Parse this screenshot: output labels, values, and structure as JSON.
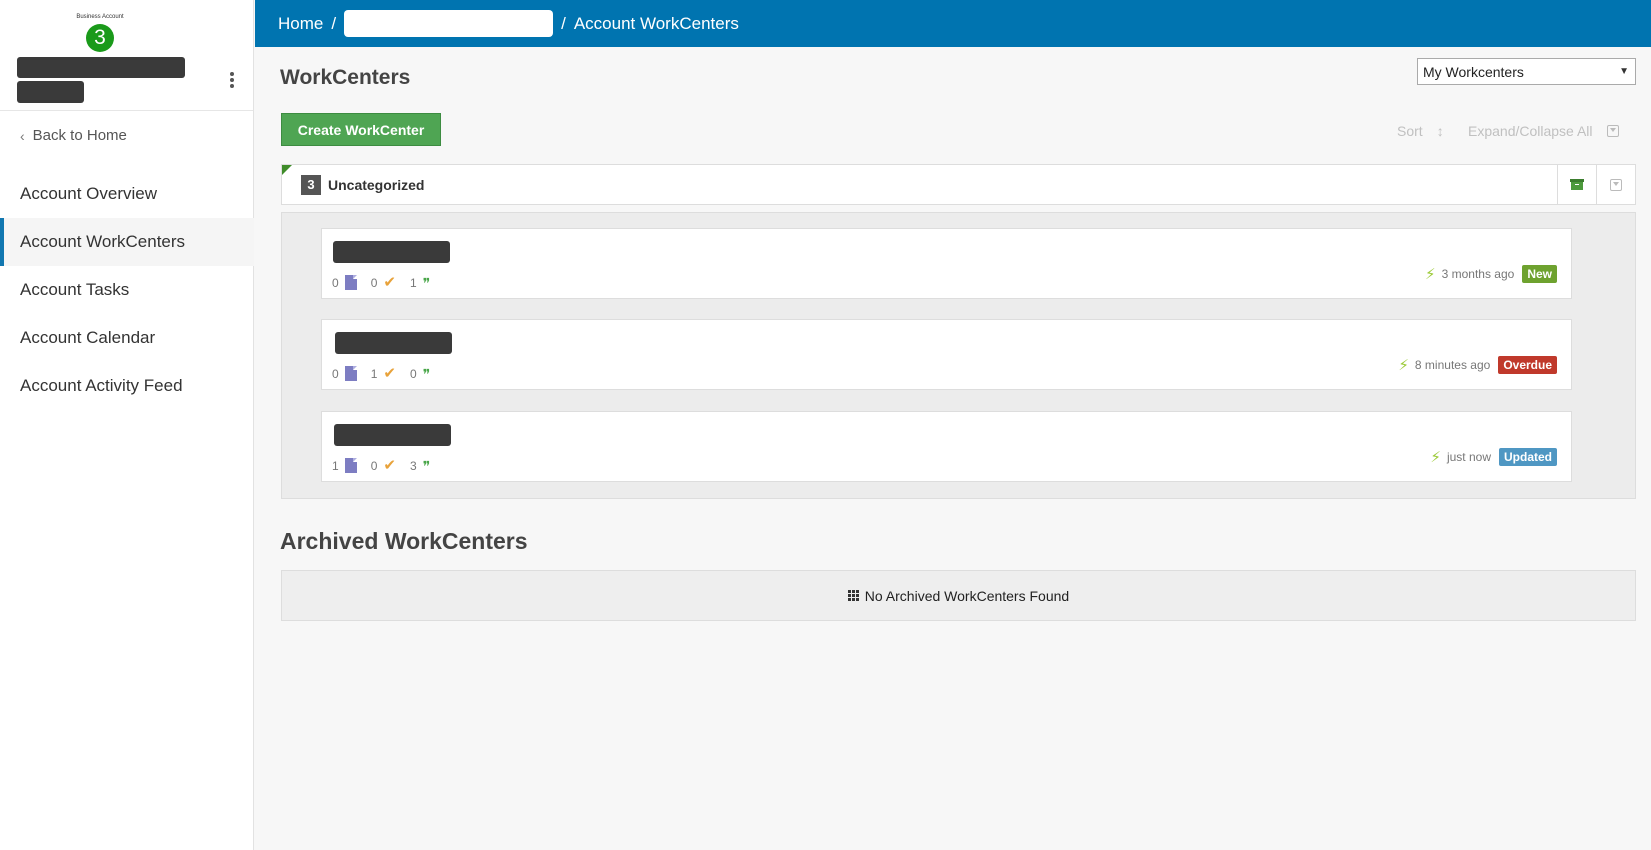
{
  "sidebar": {
    "brand_caption": "Business Account",
    "brand_badge": "3",
    "back_label": "Back to Home",
    "nav": [
      {
        "label": "Account Overview"
      },
      {
        "label": "Account WorkCenters",
        "active": true
      },
      {
        "label": "Account Tasks"
      },
      {
        "label": "Account Calendar"
      },
      {
        "label": "Account Activity Feed"
      }
    ]
  },
  "topbar": {
    "home": "Home",
    "separator": "/",
    "current": "Account WorkCenters",
    "bg_color": "#0074b0"
  },
  "main": {
    "title": "WorkCenters",
    "filter_value": "My Workcenters",
    "create_label": "Create WorkCenter",
    "sort_label": "Sort",
    "expand_label": "Expand/Collapse All",
    "group": {
      "count": "3",
      "name": "Uncategorized"
    },
    "workcenters": [
      {
        "files": "0",
        "tasks": "0",
        "comments": "1",
        "time": "3 months ago",
        "status": "New",
        "status_color": "#6ea22f"
      },
      {
        "files": "0",
        "tasks": "1",
        "comments": "0",
        "time": "8 minutes ago",
        "status": "Overdue",
        "status_color": "#c0392b"
      },
      {
        "files": "1",
        "tasks": "0",
        "comments": "3",
        "time": "just now",
        "status": "Updated",
        "status_color": "#4f97c3"
      }
    ],
    "archived_title": "Archived WorkCenters",
    "archived_empty": "No Archived WorkCenters Found"
  },
  "icons": {
    "back": "chevron-left-icon",
    "kebab": "more-vertical-icon",
    "file": "file-icon",
    "task": "check-icon",
    "comment": "comments-icon",
    "activity": "bolt-icon",
    "archive": "archive-icon",
    "collapse": "collapse-icon",
    "empty": "grid-icon"
  }
}
